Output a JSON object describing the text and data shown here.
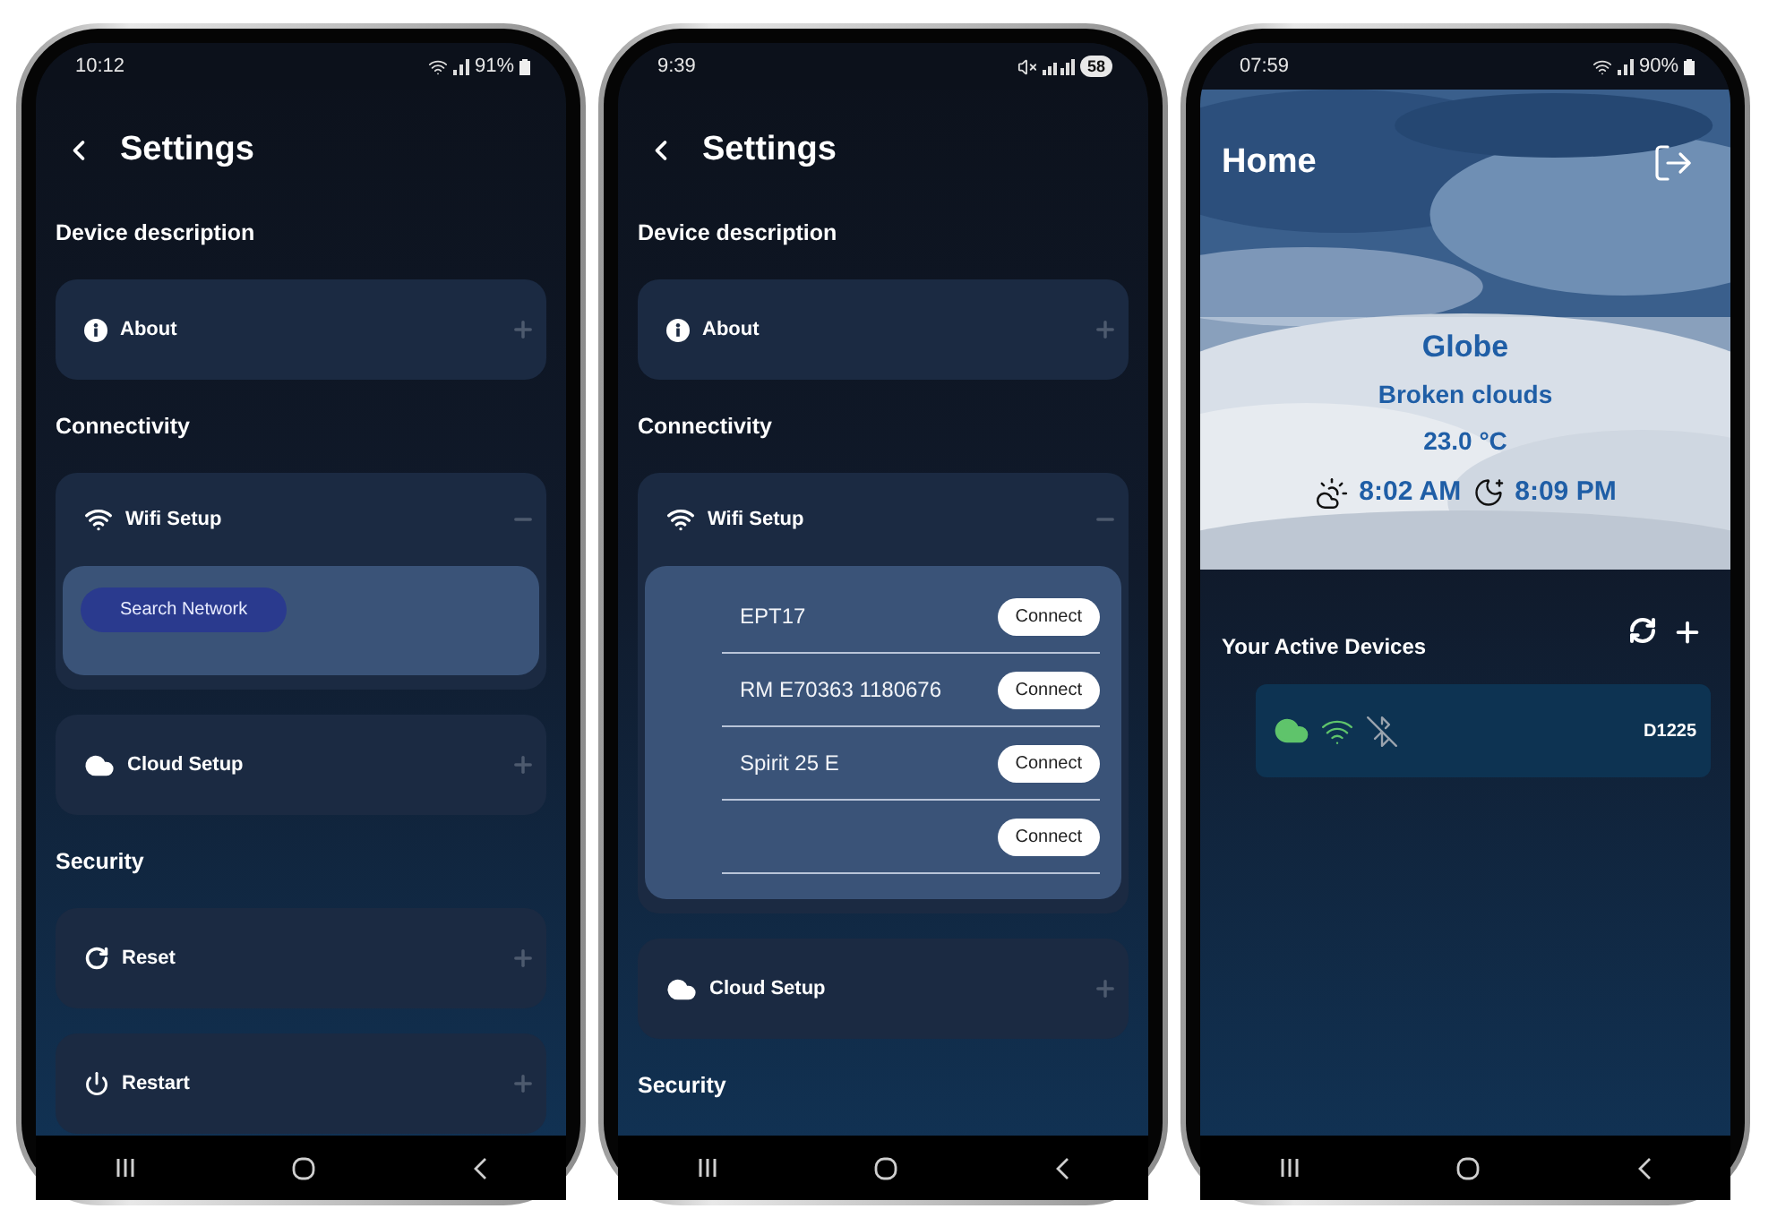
{
  "phones": [
    {
      "kind": "settings",
      "status": {
        "kind": "percent",
        "time": "10:12",
        "battery": "91%"
      },
      "title": "Settings",
      "sections": [
        {
          "heading": "Device description",
          "items": [
            {
              "kind": "info",
              "label": "About",
              "expanded": false
            }
          ]
        },
        {
          "heading": "Connectivity",
          "items": [
            {
              "kind": "wifi",
              "label": "Wifi Setup",
              "expanded": true,
              "content": {
                "kind": "search",
                "button": "Search Network"
              }
            },
            {
              "kind": "cloud",
              "label": "Cloud Setup",
              "expanded": false
            }
          ]
        },
        {
          "heading": "Security",
          "items": [
            {
              "kind": "reset",
              "label": "Reset",
              "expanded": false
            },
            {
              "kind": "power",
              "label": "Restart",
              "expanded": false
            }
          ]
        }
      ]
    },
    {
      "kind": "settings",
      "status": {
        "kind": "badge",
        "time": "9:39",
        "battery": "58"
      },
      "title": "Settings",
      "sections": [
        {
          "heading": "Device description",
          "items": [
            {
              "kind": "info",
              "label": "About",
              "expanded": false
            }
          ]
        },
        {
          "heading": "Connectivity",
          "items": [
            {
              "kind": "wifi",
              "label": "Wifi Setup",
              "expanded": true,
              "content": {
                "kind": "networks",
                "networks": [
                  {
                    "name": "EPT17",
                    "button": "Connect"
                  },
                  {
                    "name": "RM E70363 1180676",
                    "button": "Connect"
                  },
                  {
                    "name": "Spirit 25 E",
                    "button": "Connect"
                  },
                  {
                    "button": "Connect"
                  }
                ]
              }
            },
            {
              "kind": "cloud",
              "label": "Cloud Setup",
              "expanded": false
            }
          ]
        },
        {
          "heading": "Security"
        }
      ]
    },
    {
      "kind": "home",
      "status": {
        "kind": "percent",
        "time": "07:59",
        "battery": "90%"
      },
      "title": "Home",
      "weather": {
        "place": "Globe",
        "condition": "Broken clouds",
        "temperature": "23.0 °C",
        "sunrise": "8:02 AM",
        "sunset": "8:09 PM"
      },
      "devices_heading": "Your Active Devices",
      "devices": [
        {
          "name": "D1225",
          "cloud": true,
          "wifi": true,
          "bluetooth": false
        }
      ]
    }
  ]
}
